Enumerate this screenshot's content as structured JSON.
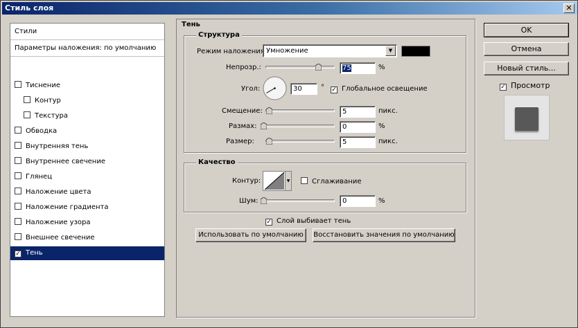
{
  "window": {
    "title": "Стиль слоя",
    "close_glyph": "✕"
  },
  "left_panel": {
    "header": "Стили",
    "blending": "Параметры наложения: по умолчанию",
    "items": [
      {
        "label": "Тиснение",
        "checked": false
      },
      {
        "label": "Контур",
        "checked": false
      },
      {
        "label": "Текстура",
        "checked": false
      },
      {
        "label": "Обводка",
        "checked": false
      },
      {
        "label": "Внутренняя тень",
        "checked": false
      },
      {
        "label": "Внутреннее свечение",
        "checked": false
      },
      {
        "label": "Глянец",
        "checked": false
      },
      {
        "label": "Наложение цвета",
        "checked": false
      },
      {
        "label": "Наложение градиента",
        "checked": false
      },
      {
        "label": "Наложение узора",
        "checked": false
      },
      {
        "label": "Внешнее свечение",
        "checked": false
      },
      {
        "label": "Тень",
        "checked": true
      }
    ]
  },
  "shadow": {
    "title": "Тень",
    "structure": {
      "title": "Структура",
      "blend_mode_label": "Режим наложения:",
      "blend_mode_value": "Умножение",
      "color": "#000000",
      "opacity_label": "Непрозр.:",
      "opacity_value": "75",
      "opacity_fraction": 0.75,
      "percent": "%",
      "angle_label": "Угол:",
      "angle_value": "30",
      "degree": "°",
      "global_light_label": "Глобальное освещение",
      "global_light_checked": true,
      "distance_label": "Смещение:",
      "distance_value": "5",
      "size_label": "Размах:",
      "size_value": "0",
      "spread_label": "Размер:",
      "spread_value": "5",
      "unit_px": "пикс."
    },
    "quality": {
      "title": "Качество",
      "contour_label": "Контур:",
      "antialias_label": "Сглаживание",
      "antialias_checked": false,
      "noise_label": "Шум:",
      "noise_value": "0",
      "percent": "%"
    },
    "knockout_label": "Слой выбивает тень",
    "knockout_checked": true,
    "make_default": "Использовать по умолчанию",
    "reset_default": "Восстановить значения по умолчанию"
  },
  "buttons": {
    "ok": "OK",
    "cancel": "Отмена",
    "new_style": "Новый стиль...",
    "preview_label": "Просмотр",
    "preview_checked": true
  },
  "check_glyph": "✓"
}
